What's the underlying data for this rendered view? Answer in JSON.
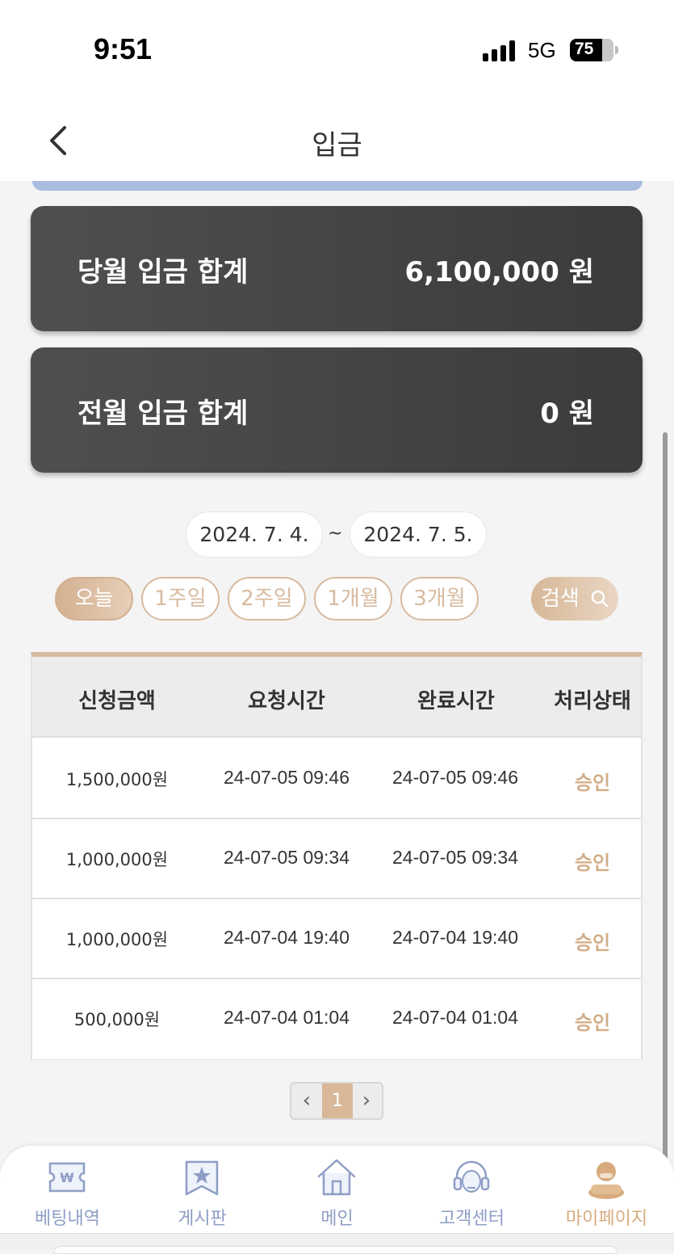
{
  "status": {
    "time": "9:51",
    "network": "5G",
    "battery": "75"
  },
  "header": {
    "title": "입금"
  },
  "summary": [
    {
      "label": "당월 입금 합계",
      "value": "6,100,000 원"
    },
    {
      "label": "전월 입금 합계",
      "value": "0 원"
    }
  ],
  "filter": {
    "start_date": "2024. 7. 4.",
    "end_date": "2024. 7. 5.",
    "separator": "~",
    "periods": [
      "오늘",
      "1주일",
      "2주일",
      "1개월",
      "3개월"
    ],
    "active_period": "오늘",
    "search_label": "검색"
  },
  "table": {
    "headers": [
      "신청금액",
      "요청시간",
      "완료시간",
      "처리상태"
    ],
    "rows": [
      {
        "amount": "1,500,000원",
        "requested": "24-07-05 09:46",
        "completed": "24-07-05 09:46",
        "status": "승인"
      },
      {
        "amount": "1,000,000원",
        "requested": "24-07-05 09:34",
        "completed": "24-07-05 09:34",
        "status": "승인"
      },
      {
        "amount": "1,000,000원",
        "requested": "24-07-04 19:40",
        "completed": "24-07-04 19:40",
        "status": "승인"
      },
      {
        "amount": "500,000원",
        "requested": "24-07-04 01:04",
        "completed": "24-07-04 01:04",
        "status": "승인"
      }
    ]
  },
  "pagination": {
    "prev": "‹",
    "current": "1",
    "next": "›"
  },
  "bottom_nav": [
    {
      "label": "베팅내역",
      "icon": "won-ticket-icon"
    },
    {
      "label": "게시판",
      "icon": "bookmark-star-icon"
    },
    {
      "label": "메인",
      "icon": "home-icon"
    },
    {
      "label": "고객센터",
      "icon": "headset-icon"
    },
    {
      "label": "마이페이지",
      "icon": "user-avatar-icon",
      "active": true
    }
  ],
  "colors": {
    "accent": "#d8b898",
    "card": "#444444",
    "nav": "#8e9ec6",
    "status": "#d3ae88"
  }
}
